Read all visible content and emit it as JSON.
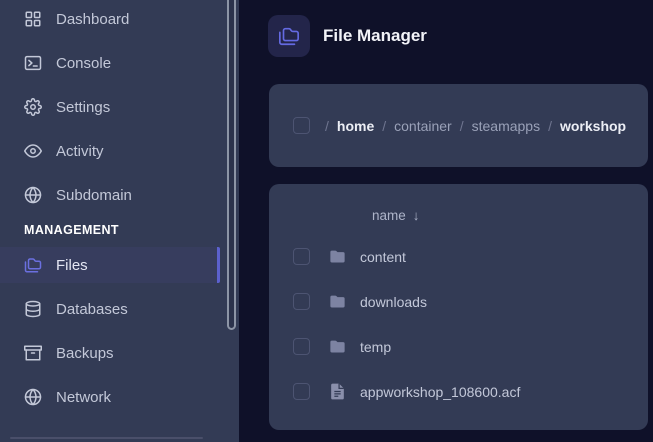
{
  "app": {
    "colors": {
      "accent": "#5c61ce",
      "main_bg": "#0f1129",
      "sidebar_bg": "#333b55",
      "panel_bg": "#333b55",
      "active_item_bg": "#373d5e"
    }
  },
  "sidebar": {
    "section_label": "MANAGEMENT",
    "items": [
      {
        "label": "Dashboard",
        "icon": "dashboard-icon"
      },
      {
        "label": "Console",
        "icon": "console-icon"
      },
      {
        "label": "Settings",
        "icon": "settings-icon"
      },
      {
        "label": "Activity",
        "icon": "activity-icon"
      },
      {
        "label": "Subdomain",
        "icon": "globe-icon"
      }
    ],
    "management_items": [
      {
        "label": "Files",
        "icon": "folders-icon",
        "active": true
      },
      {
        "label": "Databases",
        "icon": "database-icon",
        "active": false
      },
      {
        "label": "Backups",
        "icon": "archive-icon",
        "active": false
      },
      {
        "label": "Network",
        "icon": "globe-icon",
        "active": false
      }
    ]
  },
  "header": {
    "title": "File Manager",
    "icon": "folders-icon"
  },
  "breadcrumb": {
    "separator": "/",
    "segments": [
      {
        "label": "home",
        "emphasized": true
      },
      {
        "label": "container",
        "emphasized": false
      },
      {
        "label": "steamapps",
        "emphasized": false
      },
      {
        "label": "workshop",
        "emphasized": true
      }
    ]
  },
  "file_table": {
    "columns": [
      {
        "label": "name",
        "sort": "desc",
        "sort_indicator": "↓"
      }
    ],
    "rows": [
      {
        "name": "content",
        "type": "folder"
      },
      {
        "name": "downloads",
        "type": "folder"
      },
      {
        "name": "temp",
        "type": "folder"
      },
      {
        "name": "appworkshop_108600.acf",
        "type": "file"
      }
    ]
  }
}
